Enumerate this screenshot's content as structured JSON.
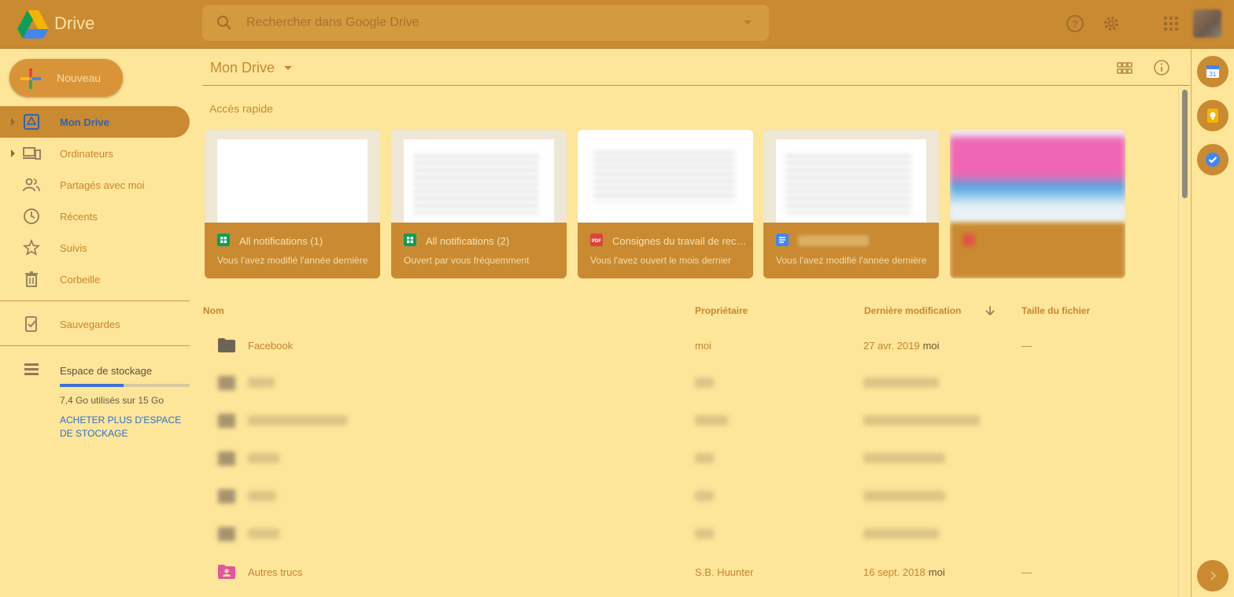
{
  "header": {
    "app_name": "Drive",
    "search_placeholder": "Rechercher dans Google Drive"
  },
  "sidebar": {
    "new_button": "Nouveau",
    "items": [
      {
        "label": "Mon Drive",
        "icon": "drive-icon",
        "active": true
      },
      {
        "label": "Ordinateurs",
        "icon": "computers-icon"
      },
      {
        "label": "Partagés avec moi",
        "icon": "people-icon"
      },
      {
        "label": "Récents",
        "icon": "clock-icon"
      },
      {
        "label": "Suivis",
        "icon": "star-icon"
      },
      {
        "label": "Corbeille",
        "icon": "trash-icon"
      }
    ],
    "backups": "Sauvegardes",
    "storage": {
      "label": "Espace de stockage",
      "used_text": "7,4 Go utilisés sur 15 Go",
      "used_fraction": 0.49,
      "buy_link": "ACHETER PLUS D'ESPACE DE STOCKAGE"
    }
  },
  "main": {
    "title": "Mon Drive",
    "quick_access_title": "Accès rapide",
    "quick_access": [
      {
        "name": "All notifications (1)",
        "sub": "Vous l'avez modifié l'année dernière",
        "type": "sheets"
      },
      {
        "name": "All notifications (2)",
        "sub": "Ouvert par vous fréquemment",
        "type": "sheets"
      },
      {
        "name": "Consignes du travail de recherche",
        "sub": "Vous l'avez ouvert le mois dernier",
        "type": "pdf"
      },
      {
        "name": "",
        "sub": "Vous l'avez modifié l'année dernière",
        "type": "docs"
      },
      {
        "name": "",
        "sub": "",
        "type": "image"
      }
    ],
    "columns": {
      "name": "Nom",
      "owner": "Propriétaire",
      "modified": "Dernière modification",
      "size": "Taille du fichier"
    },
    "rows": [
      {
        "name": "Facebook",
        "owner": "moi",
        "modified": "27 avr. 2019",
        "modified_by": "moi",
        "size": "—"
      },
      {
        "name": "Autres trucs",
        "owner": "S.B. Huunter",
        "modified": "16 sept. 2018",
        "modified_by": "moi",
        "size": "—"
      }
    ]
  },
  "colors": {
    "header": "#c98a32",
    "background": "#fde599",
    "accent_blue": "#2d62b8"
  }
}
